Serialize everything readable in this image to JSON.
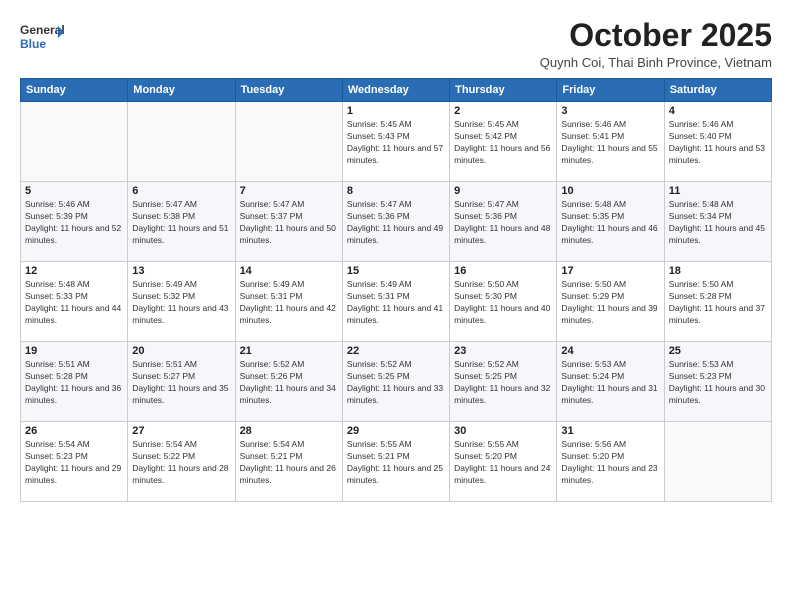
{
  "logo": {
    "general": "General",
    "blue": "Blue"
  },
  "header": {
    "month": "October 2025",
    "location": "Quynh Coi, Thai Binh Province, Vietnam"
  },
  "days_of_week": [
    "Sunday",
    "Monday",
    "Tuesday",
    "Wednesday",
    "Thursday",
    "Friday",
    "Saturday"
  ],
  "weeks": [
    [
      {
        "day": "",
        "sunrise": "",
        "sunset": "",
        "daylight": ""
      },
      {
        "day": "",
        "sunrise": "",
        "sunset": "",
        "daylight": ""
      },
      {
        "day": "",
        "sunrise": "",
        "sunset": "",
        "daylight": ""
      },
      {
        "day": "1",
        "sunrise": "Sunrise: 5:45 AM",
        "sunset": "Sunset: 5:43 PM",
        "daylight": "Daylight: 11 hours and 57 minutes."
      },
      {
        "day": "2",
        "sunrise": "Sunrise: 5:45 AM",
        "sunset": "Sunset: 5:42 PM",
        "daylight": "Daylight: 11 hours and 56 minutes."
      },
      {
        "day": "3",
        "sunrise": "Sunrise: 5:46 AM",
        "sunset": "Sunset: 5:41 PM",
        "daylight": "Daylight: 11 hours and 55 minutes."
      },
      {
        "day": "4",
        "sunrise": "Sunrise: 5:46 AM",
        "sunset": "Sunset: 5:40 PM",
        "daylight": "Daylight: 11 hours and 53 minutes."
      }
    ],
    [
      {
        "day": "5",
        "sunrise": "Sunrise: 5:46 AM",
        "sunset": "Sunset: 5:39 PM",
        "daylight": "Daylight: 11 hours and 52 minutes."
      },
      {
        "day": "6",
        "sunrise": "Sunrise: 5:47 AM",
        "sunset": "Sunset: 5:38 PM",
        "daylight": "Daylight: 11 hours and 51 minutes."
      },
      {
        "day": "7",
        "sunrise": "Sunrise: 5:47 AM",
        "sunset": "Sunset: 5:37 PM",
        "daylight": "Daylight: 11 hours and 50 minutes."
      },
      {
        "day": "8",
        "sunrise": "Sunrise: 5:47 AM",
        "sunset": "Sunset: 5:36 PM",
        "daylight": "Daylight: 11 hours and 49 minutes."
      },
      {
        "day": "9",
        "sunrise": "Sunrise: 5:47 AM",
        "sunset": "Sunset: 5:36 PM",
        "daylight": "Daylight: 11 hours and 48 minutes."
      },
      {
        "day": "10",
        "sunrise": "Sunrise: 5:48 AM",
        "sunset": "Sunset: 5:35 PM",
        "daylight": "Daylight: 11 hours and 46 minutes."
      },
      {
        "day": "11",
        "sunrise": "Sunrise: 5:48 AM",
        "sunset": "Sunset: 5:34 PM",
        "daylight": "Daylight: 11 hours and 45 minutes."
      }
    ],
    [
      {
        "day": "12",
        "sunrise": "Sunrise: 5:48 AM",
        "sunset": "Sunset: 5:33 PM",
        "daylight": "Daylight: 11 hours and 44 minutes."
      },
      {
        "day": "13",
        "sunrise": "Sunrise: 5:49 AM",
        "sunset": "Sunset: 5:32 PM",
        "daylight": "Daylight: 11 hours and 43 minutes."
      },
      {
        "day": "14",
        "sunrise": "Sunrise: 5:49 AM",
        "sunset": "Sunset: 5:31 PM",
        "daylight": "Daylight: 11 hours and 42 minutes."
      },
      {
        "day": "15",
        "sunrise": "Sunrise: 5:49 AM",
        "sunset": "Sunset: 5:31 PM",
        "daylight": "Daylight: 11 hours and 41 minutes."
      },
      {
        "day": "16",
        "sunrise": "Sunrise: 5:50 AM",
        "sunset": "Sunset: 5:30 PM",
        "daylight": "Daylight: 11 hours and 40 minutes."
      },
      {
        "day": "17",
        "sunrise": "Sunrise: 5:50 AM",
        "sunset": "Sunset: 5:29 PM",
        "daylight": "Daylight: 11 hours and 39 minutes."
      },
      {
        "day": "18",
        "sunrise": "Sunrise: 5:50 AM",
        "sunset": "Sunset: 5:28 PM",
        "daylight": "Daylight: 11 hours and 37 minutes."
      }
    ],
    [
      {
        "day": "19",
        "sunrise": "Sunrise: 5:51 AM",
        "sunset": "Sunset: 5:28 PM",
        "daylight": "Daylight: 11 hours and 36 minutes."
      },
      {
        "day": "20",
        "sunrise": "Sunrise: 5:51 AM",
        "sunset": "Sunset: 5:27 PM",
        "daylight": "Daylight: 11 hours and 35 minutes."
      },
      {
        "day": "21",
        "sunrise": "Sunrise: 5:52 AM",
        "sunset": "Sunset: 5:26 PM",
        "daylight": "Daylight: 11 hours and 34 minutes."
      },
      {
        "day": "22",
        "sunrise": "Sunrise: 5:52 AM",
        "sunset": "Sunset: 5:25 PM",
        "daylight": "Daylight: 11 hours and 33 minutes."
      },
      {
        "day": "23",
        "sunrise": "Sunrise: 5:52 AM",
        "sunset": "Sunset: 5:25 PM",
        "daylight": "Daylight: 11 hours and 32 minutes."
      },
      {
        "day": "24",
        "sunrise": "Sunrise: 5:53 AM",
        "sunset": "Sunset: 5:24 PM",
        "daylight": "Daylight: 11 hours and 31 minutes."
      },
      {
        "day": "25",
        "sunrise": "Sunrise: 5:53 AM",
        "sunset": "Sunset: 5:23 PM",
        "daylight": "Daylight: 11 hours and 30 minutes."
      }
    ],
    [
      {
        "day": "26",
        "sunrise": "Sunrise: 5:54 AM",
        "sunset": "Sunset: 5:23 PM",
        "daylight": "Daylight: 11 hours and 29 minutes."
      },
      {
        "day": "27",
        "sunrise": "Sunrise: 5:54 AM",
        "sunset": "Sunset: 5:22 PM",
        "daylight": "Daylight: 11 hours and 28 minutes."
      },
      {
        "day": "28",
        "sunrise": "Sunrise: 5:54 AM",
        "sunset": "Sunset: 5:21 PM",
        "daylight": "Daylight: 11 hours and 26 minutes."
      },
      {
        "day": "29",
        "sunrise": "Sunrise: 5:55 AM",
        "sunset": "Sunset: 5:21 PM",
        "daylight": "Daylight: 11 hours and 25 minutes."
      },
      {
        "day": "30",
        "sunrise": "Sunrise: 5:55 AM",
        "sunset": "Sunset: 5:20 PM",
        "daylight": "Daylight: 11 hours and 24 minutes."
      },
      {
        "day": "31",
        "sunrise": "Sunrise: 5:56 AM",
        "sunset": "Sunset: 5:20 PM",
        "daylight": "Daylight: 11 hours and 23 minutes."
      },
      {
        "day": "",
        "sunrise": "",
        "sunset": "",
        "daylight": ""
      }
    ]
  ]
}
